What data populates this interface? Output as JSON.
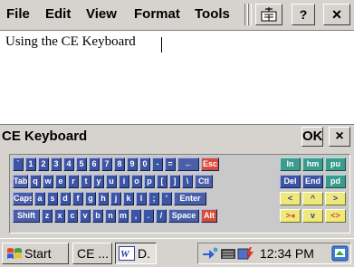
{
  "menubar": {
    "items": [
      "File",
      "Edit",
      "View",
      "Format",
      "Tools"
    ],
    "help_label": "?",
    "close_label": "×"
  },
  "document": {
    "text": "Using the CE Keyboard"
  },
  "keyboard": {
    "title": "CE Keyboard",
    "ok_label": "OK",
    "close_label": "×",
    "rows": [
      [
        "`",
        "1",
        "2",
        "3",
        "4",
        "5",
        "6",
        "7",
        "8",
        "9",
        "0",
        "-",
        "=",
        "←",
        "Esc"
      ],
      [
        "Tab",
        "q",
        "w",
        "e",
        "r",
        "t",
        "y",
        "u",
        "i",
        "o",
        "p",
        "[",
        "]",
        "\\",
        "Ctl"
      ],
      [
        "Caps",
        "a",
        "s",
        "d",
        "f",
        "g",
        "h",
        "j",
        "k",
        "l",
        ";",
        "'",
        "Enter"
      ],
      [
        "Shift",
        "z",
        "x",
        "c",
        "v",
        "b",
        "n",
        "m",
        ",",
        ".",
        "/",
        "Space",
        "Alt"
      ]
    ],
    "nav_keys": [
      [
        "In",
        "hm",
        "pu"
      ],
      [
        "Del",
        "End",
        "pd"
      ],
      [
        "<",
        "^",
        ">"
      ],
      [
        ">◂",
        "v",
        "<>"
      ]
    ]
  },
  "taskbar": {
    "start_label": "Start",
    "task1_label": "CE ...",
    "task2_label": "D.",
    "clock": "12:34 PM"
  }
}
